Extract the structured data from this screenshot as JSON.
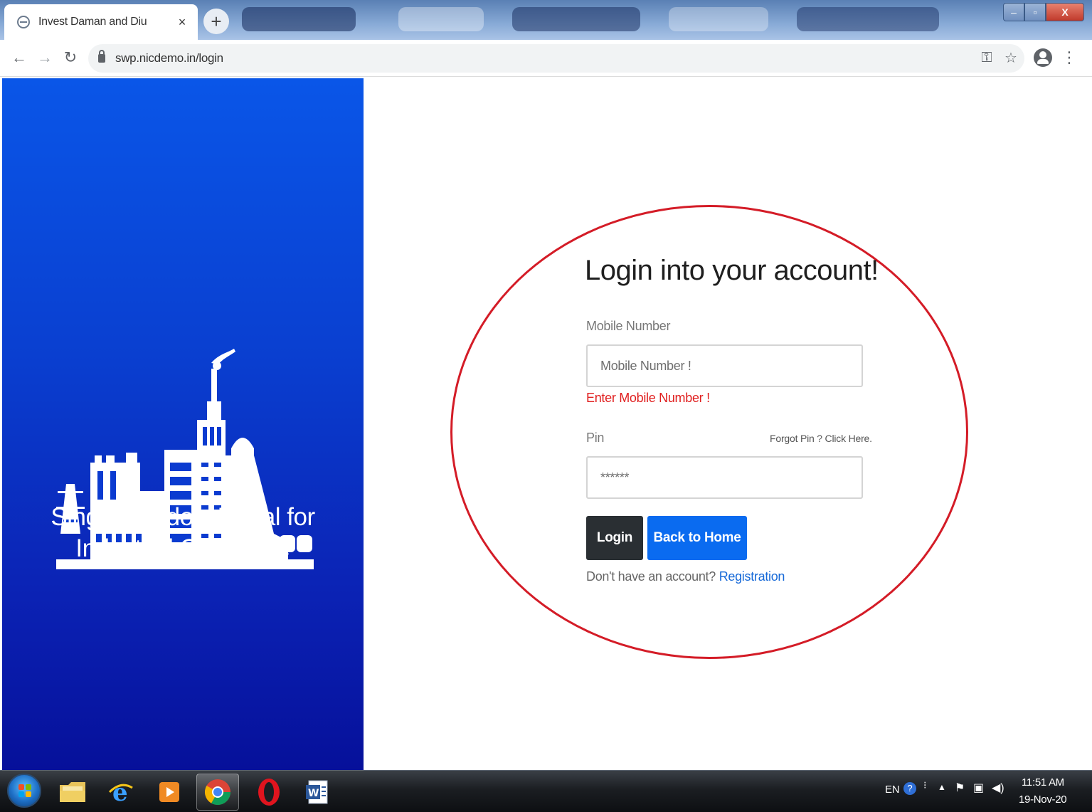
{
  "browser": {
    "tab_title": "Invest Daman and Diu",
    "tab_close": "×",
    "new_tab": "+",
    "url": "swp.nicdemo.in/login",
    "window_minimize": "–",
    "window_maximize": "▫",
    "window_close": "X"
  },
  "brand": {
    "title_line1": "Single Window Portal for",
    "title_line2": "Industrial Clearance"
  },
  "login": {
    "heading": "Login into your account!",
    "mobile_label": "Mobile Number",
    "mobile_placeholder": "Mobile Number !",
    "mobile_error": "Enter Mobile Number !",
    "pin_label": "Pin",
    "forgot_pin": "Forgot Pin ? Click Here.",
    "pin_placeholder": "******",
    "login_button": "Login",
    "back_home_button": "Back to Home",
    "no_account_text": "Don't have an account?",
    "registration_link": "Registration"
  },
  "taskbar": {
    "language": "EN",
    "time": "11:51 AM",
    "date": "19-Nov-20"
  },
  "colors": {
    "brand_blue_top": "#0a56e8",
    "brand_blue_bottom": "#06109a",
    "error_red": "#e01f1f",
    "primary_blue": "#0a6bf0",
    "dark_button": "#2a2f33",
    "annotation_red": "#d41c27"
  }
}
